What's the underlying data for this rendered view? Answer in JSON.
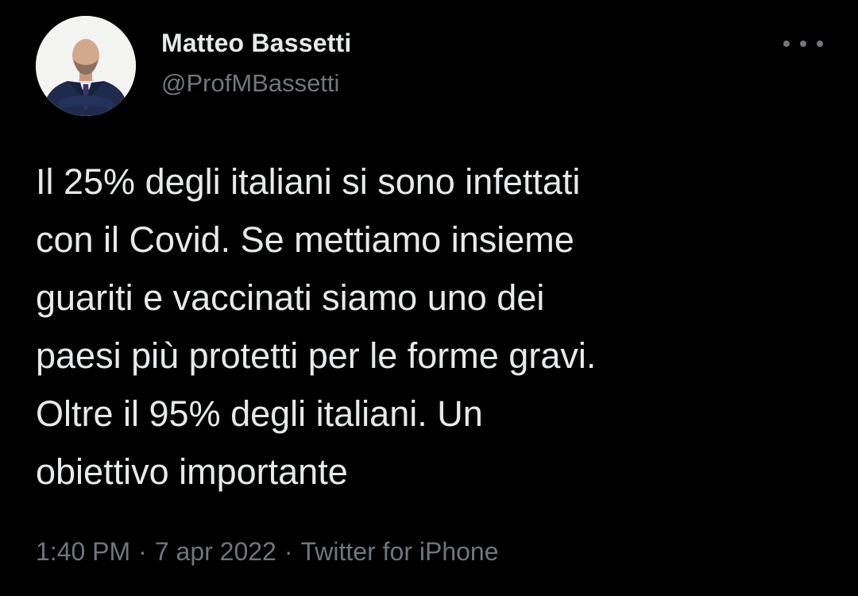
{
  "author": {
    "display_name": "Matteo Bassetti",
    "handle": "@ProfMBassetti",
    "avatar_icon": "profile-photo"
  },
  "more_icon": "more-options-icon",
  "tweet": {
    "lines": [
      "Il 25% degli italiani si sono infettati",
      "con il Covid. Se mettiamo insieme",
      "guariti e vaccinati siamo uno dei",
      "paesi più protetti per le forme gravi.",
      "Oltre il 95% degli italiani. Un",
      "obiettivo importante"
    ]
  },
  "meta": {
    "time": "1:40 PM",
    "date": "7 apr 2022",
    "source": "Twitter for iPhone",
    "separator": "·"
  },
  "colors": {
    "background": "#000000",
    "primary_text": "#e7e9ea",
    "secondary_text": "#71767b"
  }
}
